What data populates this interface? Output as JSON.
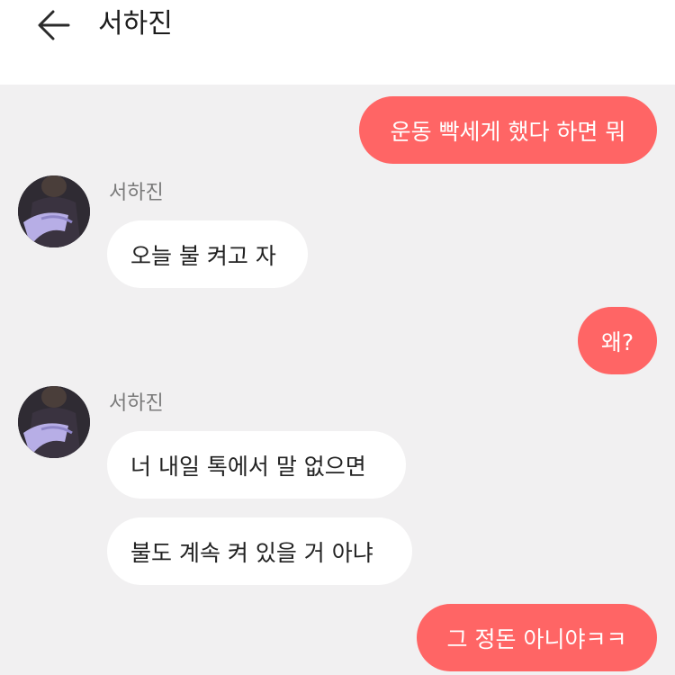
{
  "header": {
    "title": "서하진",
    "back_icon": "arrow-left-icon"
  },
  "messages": {
    "m1": {
      "text": "운동 빡세게 했다 하면 뭐",
      "from": "me"
    },
    "m2": {
      "sender": "서하진",
      "text": "오늘 불 켜고 자",
      "from": "other"
    },
    "m3": {
      "text": "왜?",
      "from": "me"
    },
    "m4": {
      "sender": "서하진",
      "text": "너 내일 톡에서 말 없으면",
      "from": "other"
    },
    "m5": {
      "text": "불도 계속 켜 있을 거 아냐",
      "from": "other"
    },
    "m6": {
      "text": "그 정돈 아니야ㅋㅋ",
      "from": "me"
    }
  },
  "colors": {
    "sent_bubble": "#ff6565",
    "received_bubble": "#ffffff",
    "chat_background": "#f1f0f1",
    "header_background": "#ffffff"
  }
}
